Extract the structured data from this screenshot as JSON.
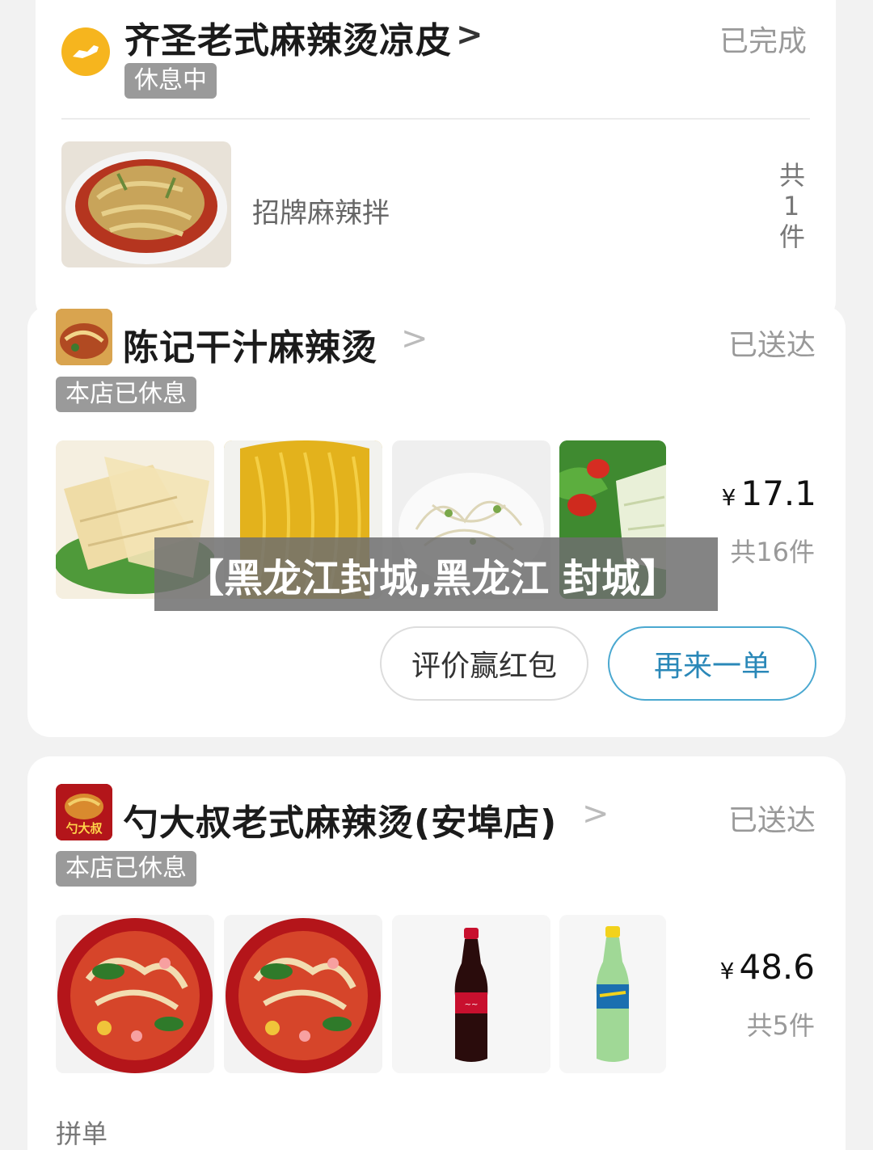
{
  "orders": [
    {
      "shop_name": "齐圣老式麻辣烫凉皮",
      "chevron": ">",
      "status": "已完成",
      "badge": "休息中",
      "item_name": "招牌麻辣拌",
      "count_vertical": [
        "共",
        "1",
        "件"
      ],
      "logo_icon": "camel-logo-icon"
    },
    {
      "shop_name": "陈记干汁麻辣烫",
      "chevron": ">",
      "status": "已送达",
      "badge": "本店已休息",
      "currency": "¥",
      "price": "17.1",
      "count": "共16件",
      "buttons": {
        "review": "评价赢红包",
        "reorder": "再来一单"
      }
    },
    {
      "shop_name": "勺大叔老式麻辣烫(安埠店)",
      "chevron": ">",
      "status": "已送达",
      "badge": "本店已休息",
      "currency": "¥",
      "price": "48.6",
      "count": "共5件",
      "logo_text": "勺大叔",
      "footer_label": "拼单"
    }
  ],
  "watermark": "【黑龙江封城,黑龙江 封城】",
  "colors": {
    "accent_blue": "#2a88b8",
    "badge_gray": "#9a9a9a",
    "logo_yellow": "#f6b51e",
    "cola_red": "#c8102e",
    "sprite_green": "#5bb84a"
  }
}
